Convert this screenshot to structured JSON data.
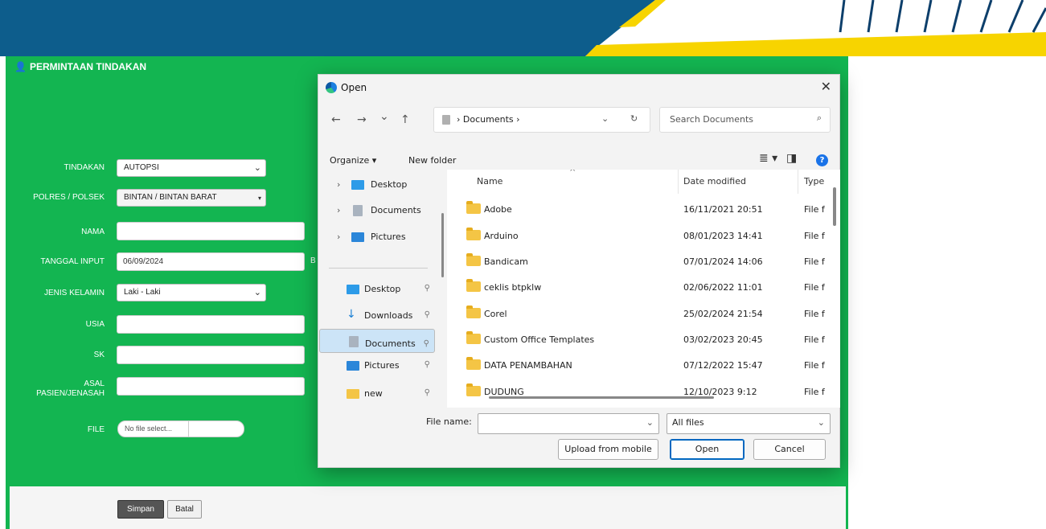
{
  "page": {
    "section_title": "PERMINTAAN TINDAKAN",
    "form": {
      "tindakan": {
        "label": "TINDAKAN",
        "value": "AUTOPSI"
      },
      "polres": {
        "label": "POLRES / POLSEK",
        "value": "BINTAN / BINTAN BARAT"
      },
      "nama": {
        "label": "NAMA",
        "value": ""
      },
      "tanggal": {
        "label": "TANGGAL INPUT",
        "value": "06/09/2024",
        "clipped_text": "B"
      },
      "jenis_kelamin": {
        "label": "JENIS KELAMIN",
        "value": "Laki - Laki"
      },
      "usia": {
        "label": "USIA",
        "value": ""
      },
      "sk": {
        "label": "SK",
        "value": ""
      },
      "asal": {
        "label_line1": "ASAL",
        "label_line2": "PASIEN/JENASAH",
        "value": ""
      },
      "file": {
        "label": "FILE",
        "value": "No file select..."
      }
    },
    "buttons": {
      "simpan": "Simpan",
      "batal": "Batal"
    },
    "colors": {
      "green": "#13b551",
      "banner_blue": "#0d5d8c",
      "banner_yellow": "#f7d400"
    }
  },
  "dialog": {
    "title": "Open",
    "close": "✕",
    "nav": {
      "back": "←",
      "forward": "→",
      "recent": "⌄",
      "up": "↑"
    },
    "address": {
      "path": "› Documents ›",
      "dropdown": "⌄",
      "refresh": "↻"
    },
    "search": {
      "placeholder": "Search Documents",
      "icon": "⌕"
    },
    "toolbar": {
      "organize": "Organize ▾",
      "new_folder": "New folder",
      "view": "≣ ▾",
      "pane": "◨",
      "help": "?"
    },
    "tree": [
      {
        "label": "Desktop",
        "caret": "›",
        "color": "#2d9be8"
      },
      {
        "label": "Documents",
        "caret": "›",
        "color": "#a9b3bf"
      },
      {
        "label": "Pictures",
        "caret": "›",
        "color": "#2b86d9"
      }
    ],
    "quick": [
      {
        "label": "Desktop",
        "pin": "📌",
        "color": "#2d9be8"
      },
      {
        "label": "Downloads",
        "pin": "📌",
        "color": "#1a7fd4",
        "glyph": "↓"
      },
      {
        "label": "Documents",
        "pin": "📌",
        "color": "#a9b3bf"
      },
      {
        "label": "Pictures",
        "pin": "📌",
        "color": "#2b86d9"
      },
      {
        "label": "new",
        "pin": "📌",
        "color": "#f4c545"
      }
    ],
    "columns": {
      "name": "Name",
      "date": "Date modified",
      "type": "Type",
      "sort": "^"
    },
    "files": [
      {
        "name": "Adobe",
        "date": "16/11/2021 20:51",
        "type": "File f"
      },
      {
        "name": "Arduino",
        "date": "08/01/2023 14:41",
        "type": "File f"
      },
      {
        "name": "Bandicam",
        "date": "07/01/2024 14:06",
        "type": "File f"
      },
      {
        "name": "ceklis btpklw",
        "date": "02/06/2022 11:01",
        "type": "File f"
      },
      {
        "name": "Corel",
        "date": "25/02/2024 21:54",
        "type": "File f"
      },
      {
        "name": "Custom Office Templates",
        "date": "03/02/2023 20:45",
        "type": "File f"
      },
      {
        "name": "DATA PENAMBAHAN",
        "date": "07/12/2022 15:47",
        "type": "File f"
      },
      {
        "name": "DUDUNG",
        "date": "12/10/2023 9:12",
        "type": "File f"
      }
    ],
    "file_name_label": "File name:",
    "file_name_value": "",
    "file_type": "All files",
    "buttons": {
      "upload": "Upload from mobile",
      "open": "Open",
      "cancel": "Cancel"
    }
  }
}
